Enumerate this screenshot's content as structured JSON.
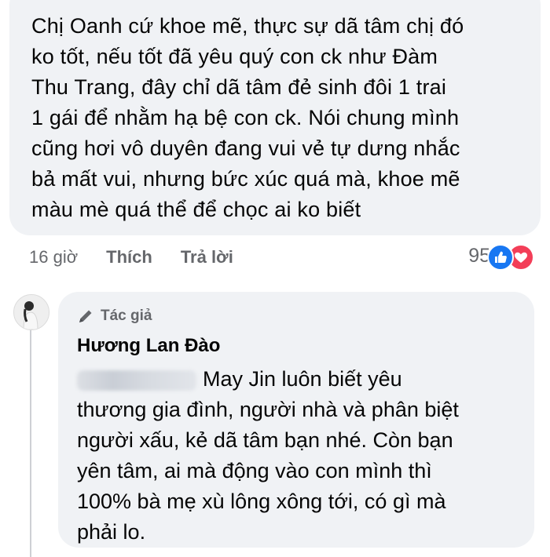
{
  "comment": {
    "text": "Chị Oanh cứ khoe mẽ, thực sự dã tâm chị đó\nko tốt, nếu tốt đã yêu quý con ck như Đàm\nThu Trang, đây chỉ dã tâm đẻ sinh đôi 1 trai\n1 gái để nhằm hạ bệ con ck. Nói chung mình\ncũng hơi vô duyên đang vui vẻ tự dưng nhắc\nbả mất vui, nhưng bức xúc quá mà, khoe mẽ\nmàu mè quá thể để chọc ai ko biết",
    "time": "16 giờ",
    "like_label": "Thích",
    "reply_label": "Trả lời",
    "reaction_count": "95",
    "reaction_icons": [
      "like-icon",
      "love-icon"
    ],
    "colors": {
      "like": "#1877f2",
      "love": "#f33e58",
      "bubble": "#f0f2f5",
      "meta": "#65676b"
    }
  },
  "reply": {
    "author_badge": "Tác giả",
    "author_name": "Hương Lan Đào",
    "text": "May Jin luôn biết yêu\nthương gia đình, người nhà và phân biệt\nngười xấu, kẻ dã tâm bạn nhé. Còn bạn\nyên tâm, ai mà động vào con mình thì\n100% bà mẹ xù lông xông tới, có gì mà\nphải lo."
  }
}
